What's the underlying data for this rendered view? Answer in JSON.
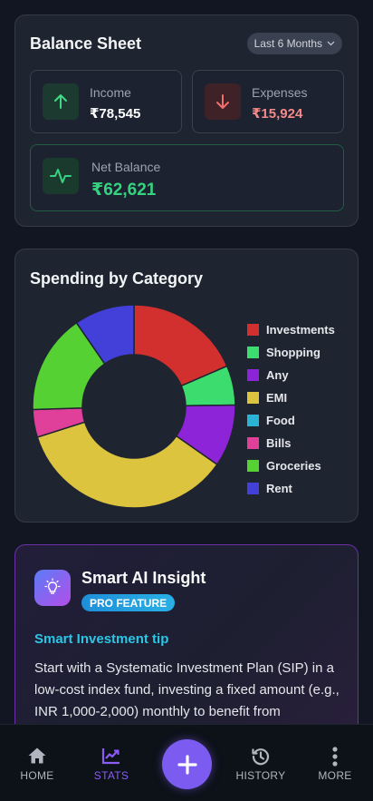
{
  "balance_sheet": {
    "title": "Balance Sheet",
    "range": "Last 6 Months",
    "income": {
      "label": "Income",
      "value": "₹78,545",
      "color": "#ffffff"
    },
    "expenses": {
      "label": "Expenses",
      "value": "₹15,924",
      "color": "#f58a8a"
    },
    "net": {
      "label": "Net Balance",
      "value": "₹62,621",
      "color": "#34d37f"
    }
  },
  "spending": {
    "title": "Spending by Category",
    "legend": [
      {
        "label": "Investments",
        "color": "#d22f2f"
      },
      {
        "label": "Shopping",
        "color": "#3ddc6e"
      },
      {
        "label": "Any",
        "color": "#8e24d8"
      },
      {
        "label": "EMI",
        "color": "#dcc43f"
      },
      {
        "label": "Food",
        "color": "#2bb3d6"
      },
      {
        "label": "Bills",
        "color": "#e0409a"
      },
      {
        "label": "Groceries",
        "color": "#55d133"
      },
      {
        "label": "Rent",
        "color": "#4240d8"
      }
    ]
  },
  "chart_data": {
    "type": "pie",
    "categories": [
      "Investments",
      "Shopping",
      "Any",
      "EMI",
      "Food",
      "Bills",
      "Groceries",
      "Rent"
    ],
    "values": [
      18.5,
      6.3,
      9.9,
      35.4,
      0,
      4.4,
      15.9,
      9.6
    ],
    "colors": [
      "#d22f2f",
      "#3ddc6e",
      "#8e24d8",
      "#dcc43f",
      "#2bb3d6",
      "#e0409a",
      "#55d133",
      "#4240d8"
    ],
    "title": "Spending by Category",
    "legend_position": "right"
  },
  "insight": {
    "title": "Smart AI Insight",
    "badge": "PRO FEATURE",
    "tip_title": "Smart Investment tip",
    "tip_body": "Start with a Systematic Investment Plan (SIP) in a low-cost index fund, investing a fixed amount (e.g., INR 1,000-2,000) monthly to benefit from"
  },
  "nav": {
    "home": "HOME",
    "stats": "STATS",
    "history": "HISTORY",
    "more": "MORE",
    "active_color": "#8b5cf6"
  }
}
